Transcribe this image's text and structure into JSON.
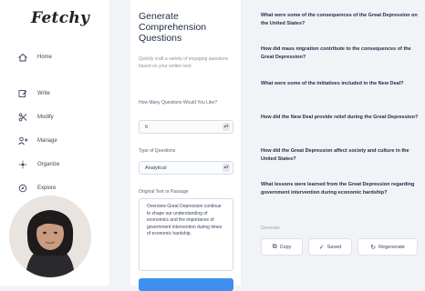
{
  "app": {
    "logo": "Fetchy"
  },
  "sidebar": {
    "items": [
      {
        "label": "Home",
        "icon": "home-icon"
      },
      {
        "label": "Write",
        "icon": "write-icon"
      },
      {
        "label": "Modify",
        "icon": "modify-icon"
      },
      {
        "label": "Manage",
        "icon": "manage-icon"
      },
      {
        "label": "Organize",
        "icon": "organize-icon"
      },
      {
        "label": "Explore",
        "icon": "explore-icon"
      }
    ]
  },
  "form": {
    "title": "Generate Comprehension Questions",
    "description": "Quickly craft a variety of engaging questions based on your written text.",
    "count_label": "How Many Questions Would You Like?",
    "count_value": "6",
    "type_label": "Type of Questions",
    "type_value": "Analytical",
    "passage_label": "Original Text or Passage",
    "passage_text": "Overview Great Depression continue to shape our understanding of economics and the importance of government intervention during times of economic hardship."
  },
  "output": {
    "questions": [
      "What were some of the consequences of the Great Depression on the United States?",
      "How did mass migration contribute to the consequences of the Great Depression?",
      "What were some of the initiatives included in the New Deal?",
      "How did the New Deal provide relief during the Great Depression?",
      "How did the Great Depression affect society and culture in the United States?",
      "What lessons were learned from the Great Depression regarding government intervention during economic hardship?"
    ],
    "label": "Generate",
    "actions": {
      "copy": "Copy",
      "saved": "Saved",
      "regenerate": "Regenerate"
    }
  }
}
